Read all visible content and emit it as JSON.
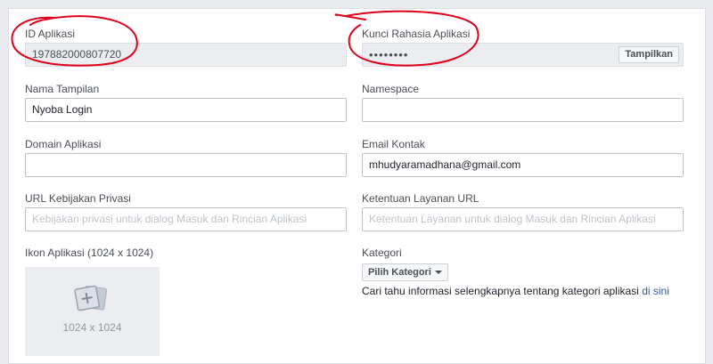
{
  "app_id": {
    "label": "ID Aplikasi",
    "value": "197882000807720"
  },
  "app_secret": {
    "label": "Kunci Rahasia Aplikasi",
    "value": "••••••••",
    "show_label": "Tampilkan"
  },
  "display_name": {
    "label": "Nama Tampilan",
    "value": "Nyoba Login"
  },
  "namespace": {
    "label": "Namespace",
    "value": ""
  },
  "app_domains": {
    "label": "Domain Aplikasi",
    "value": ""
  },
  "contact_email": {
    "label": "Email Kontak",
    "value": "mhudyaramadhana@gmail.com"
  },
  "privacy_url": {
    "label": "URL Kebijakan Privasi",
    "placeholder": "Kebijakan privasi untuk dialog Masuk dan Rincian Aplikasi"
  },
  "terms_url": {
    "label": "Ketentuan Layanan URL",
    "placeholder": "Ketentuan Layanan untuk dialog Masuk dan Rincian Aplikasi"
  },
  "app_icon": {
    "label": "Ikon Aplikasi (1024 x 1024)",
    "size_text": "1024 x 1024",
    "icon": "add-image-icon"
  },
  "category": {
    "label": "Kategori",
    "button_label": "Pilih Kategori",
    "help_text": "Cari tahu informasi selengkapnya tentang kategori aplikasi ",
    "help_link": "di sini"
  },
  "colors": {
    "annotation": "#e0001b",
    "link": "#365899",
    "readonly_bg": "#ebedf0",
    "page_bg": "#e9ebee"
  }
}
